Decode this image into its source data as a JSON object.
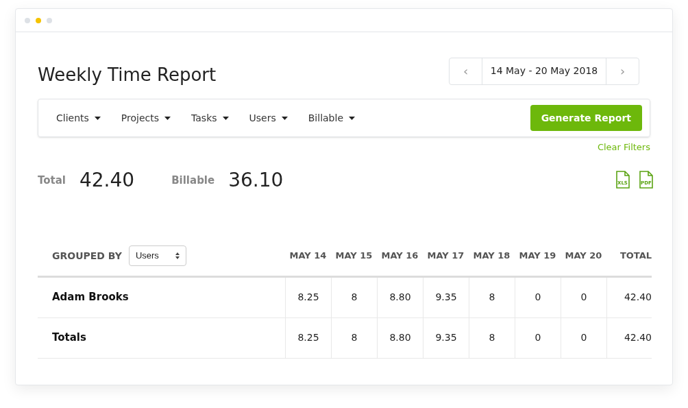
{
  "window": {
    "dots": [
      {
        "color": "#dde1e6"
      },
      {
        "color": "#f5c300"
      },
      {
        "color": "#dde1e6"
      }
    ]
  },
  "title": "Weekly Time Report",
  "date_range": {
    "prev": "‹",
    "label": "14 May - 20 May 2018",
    "next": "›"
  },
  "filters": [
    "Clients",
    "Projects",
    "Tasks",
    "Users",
    "Billable"
  ],
  "generate_button": "Generate Report",
  "clear_filters": "Clear Filters",
  "summary": [
    {
      "label": "Total",
      "value": "42.40"
    },
    {
      "label": "Billable",
      "value": "36.10"
    }
  ],
  "exports": [
    "XLS",
    "PDF"
  ],
  "table": {
    "grouped_by_label": "GROUPED BY",
    "grouped_by_value": "Users",
    "columns": [
      "MAY 14",
      "MAY 15",
      "MAY 16",
      "MAY 17",
      "MAY 18",
      "MAY 19",
      "MAY 20",
      "TOTAL"
    ],
    "rows": [
      {
        "name": "Adam Brooks",
        "cells": [
          "8.25",
          "8",
          "8.80",
          "9.35",
          "8",
          "0",
          "0",
          "42.40"
        ]
      },
      {
        "name": "Totals",
        "cells": [
          "8.25",
          "8",
          "8.80",
          "9.35",
          "8",
          "0",
          "0",
          "42.40"
        ]
      }
    ]
  }
}
